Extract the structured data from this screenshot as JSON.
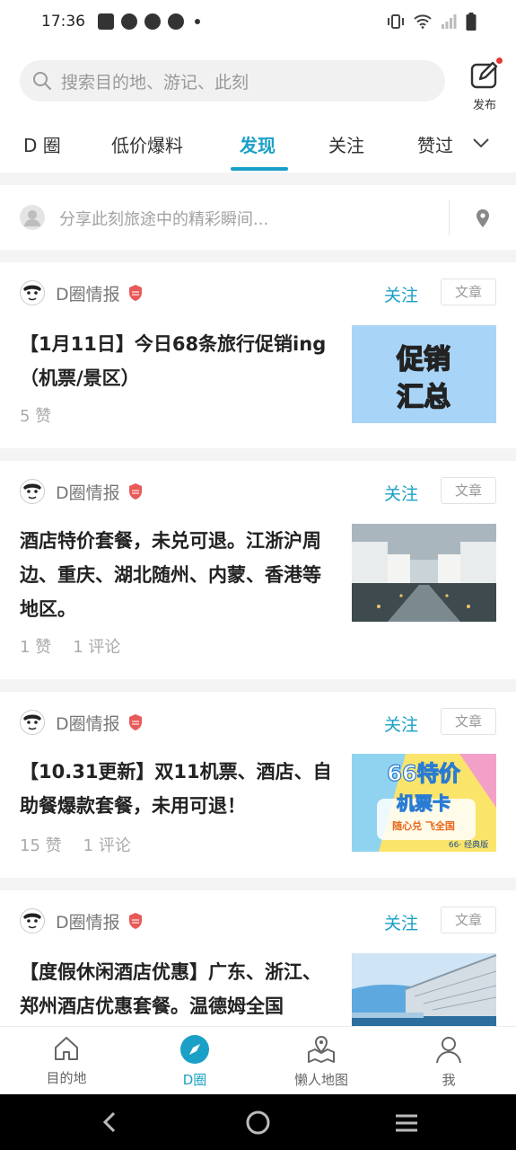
{
  "status_bar": {
    "time": "17:36",
    "icons": [
      "notification-icon",
      "app-icon",
      "app-icon",
      "app-icon",
      "dot-icon",
      "vibrate-icon",
      "wifi-icon",
      "signal-icon",
      "battery-icon"
    ]
  },
  "search": {
    "placeholder": "搜索目的地、游记、此刻",
    "publish_label": "发布"
  },
  "tabs": [
    {
      "label": "D 圈",
      "active": false
    },
    {
      "label": "低价爆料",
      "active": false
    },
    {
      "label": "发现",
      "active": true
    },
    {
      "label": "关注",
      "active": false
    },
    {
      "label": "赞过",
      "active": false
    }
  ],
  "share_bar": {
    "placeholder": "分享此刻旅途中的精彩瞬间..."
  },
  "posts": [
    {
      "author": "D圈情报",
      "follow_label": "关注",
      "type_label": "文章",
      "title": "【1月11日】今日68条旅行促销ing（机票/景区）",
      "likes": "5 赞",
      "comments": "",
      "thumb": "promo",
      "thumb_text": [
        "促销",
        "汇总"
      ]
    },
    {
      "author": "D圈情报",
      "follow_label": "关注",
      "type_label": "文章",
      "title": "酒店特价套餐，未兑可退。江浙沪周边、重庆、湖北随州、内蒙、香港等地区。",
      "likes": "1 赞",
      "comments": "1 评论",
      "thumb": "hotel",
      "thumb_text": []
    },
    {
      "author": "D圈情报",
      "follow_label": "关注",
      "type_label": "文章",
      "title": "【10.31更新】双11机票、酒店、自助餐爆款套餐，未用可退！",
      "likes": "15 赞",
      "comments": "1 评论",
      "thumb": "ticket",
      "thumb_text": [
        "66特价",
        "机票卡",
        "随心兑 飞全国",
        "66· 经典版"
      ]
    },
    {
      "author": "D圈情报",
      "follow_label": "关注",
      "type_label": "文章",
      "title": "【度假休闲酒店优惠】广东、浙江、郑州酒店优惠套餐。温德姆全国",
      "likes": "",
      "comments": "",
      "thumb": "building",
      "thumb_text": []
    }
  ],
  "bottom_nav": [
    {
      "label": "目的地",
      "icon": "home-icon",
      "active": false
    },
    {
      "label": "D圈",
      "icon": "compass-icon",
      "active": true
    },
    {
      "label": "懒人地图",
      "icon": "map-icon",
      "active": false
    },
    {
      "label": "我",
      "icon": "profile-icon",
      "active": false
    }
  ],
  "colors": {
    "accent": "#1aa0c7",
    "badge": "#e85a5a",
    "promo_bg": "#a8d4f8",
    "promo_text": "#f7d43b"
  }
}
